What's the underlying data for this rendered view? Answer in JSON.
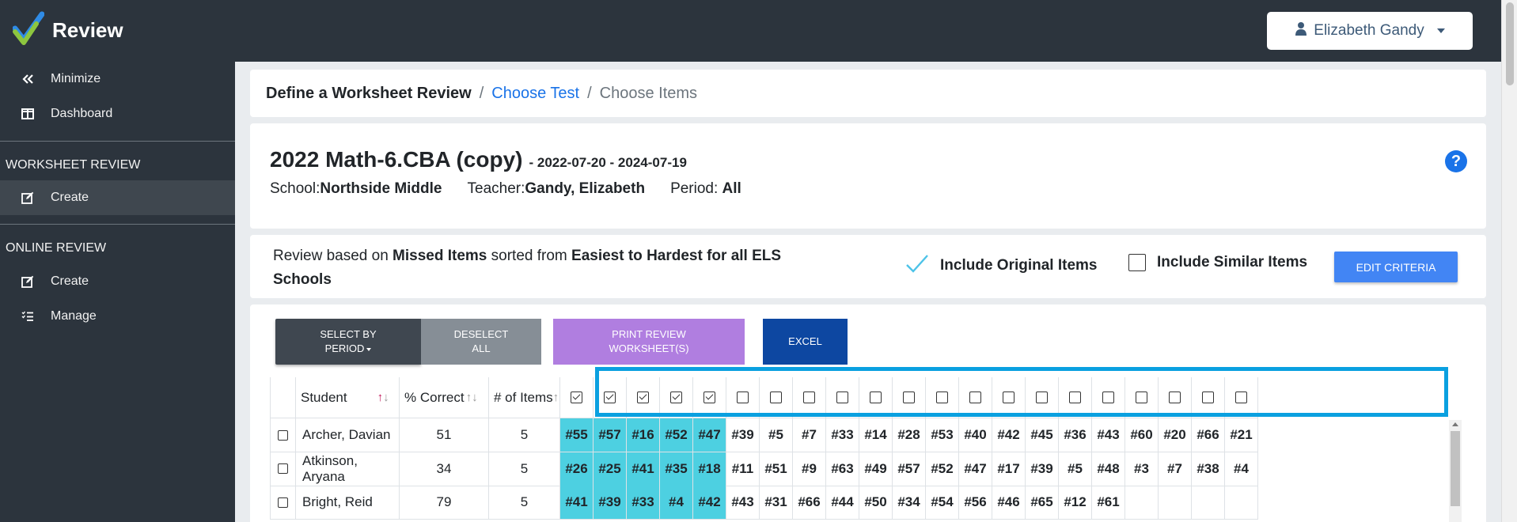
{
  "app": {
    "title": "Review",
    "user_name": "Elizabeth Gandy"
  },
  "sidebar": {
    "minimize": "Minimize",
    "dashboard": "Dashboard",
    "worksheet_section": "WORKSHEET REVIEW",
    "worksheet_create": "Create",
    "online_section": "ONLINE REVIEW",
    "online_create": "Create",
    "online_manage": "Manage"
  },
  "breadcrumb": {
    "step1": "Define a Worksheet Review",
    "sep": "/",
    "step2": "Choose Test",
    "step3": "Choose Items"
  },
  "test": {
    "name": "2022 Math-6.CBA (copy)",
    "dates": "- 2022-07-20 - 2024-07-19",
    "school_label": "School:",
    "school": "Northside Middle",
    "teacher_label": "Teacher:",
    "teacher": "Gandy, Elizabeth",
    "period_label": "Period:",
    "period": "All",
    "help": "?"
  },
  "criteria": {
    "pre": "Review based on ",
    "basis": "Missed Items",
    "mid": " sorted from ",
    "order": "Easiest to Hardest for all ELS Schools",
    "include_original": "Include Original Items",
    "include_similar": "Include Similar Items",
    "edit_button": "EDIT CRITERIA"
  },
  "toolbar": {
    "select_by_period_1": "SELECT BY",
    "select_by_period_2": "PERIOD",
    "deselect_1": "DESELECT",
    "deselect_2": "ALL",
    "print_1": "PRINT REVIEW",
    "print_2": "WORKSHEET(S)",
    "excel": "EXCEL"
  },
  "table": {
    "headers": {
      "student": "Student",
      "pct": "% Correct",
      "items": "# of Items"
    },
    "item_checked": [
      true,
      true,
      true,
      true,
      true,
      false,
      false,
      false,
      false,
      false,
      false,
      false,
      false,
      false,
      false,
      false,
      false,
      false,
      false,
      false,
      false
    ],
    "rows": [
      {
        "student": "Archer, Davian",
        "pct": "51",
        "count": "5",
        "items": [
          "#55",
          "#57",
          "#16",
          "#52",
          "#47",
          "#39",
          "#5",
          "#7",
          "#33",
          "#14",
          "#28",
          "#53",
          "#40",
          "#42",
          "#45",
          "#36",
          "#43",
          "#60",
          "#20",
          "#66",
          "#21"
        ]
      },
      {
        "student": "Atkinson, Aryana",
        "pct": "34",
        "count": "5",
        "items": [
          "#26",
          "#25",
          "#41",
          "#35",
          "#18",
          "#11",
          "#51",
          "#9",
          "#63",
          "#49",
          "#57",
          "#52",
          "#47",
          "#17",
          "#39",
          "#5",
          "#48",
          "#3",
          "#7",
          "#38",
          "#4"
        ]
      },
      {
        "student": "Bright, Reid",
        "pct": "79",
        "count": "5",
        "items": [
          "#41",
          "#39",
          "#33",
          "#4",
          "#42",
          "#43",
          "#31",
          "#66",
          "#44",
          "#50",
          "#34",
          "#54",
          "#56",
          "#46",
          "#65",
          "#12",
          "#61",
          "",
          "",
          "",
          ""
        ]
      }
    ]
  },
  "colors": {
    "teal": "#4dd0e1",
    "highlight": "#0aa0e0",
    "sidebar": "#2c343d",
    "accent": "#4285f4"
  }
}
